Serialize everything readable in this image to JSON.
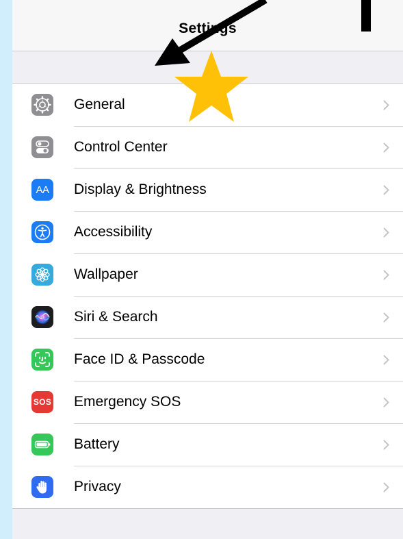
{
  "nav": {
    "title": "Settings"
  },
  "rows": [
    {
      "label": "General",
      "icon": "gear-icon",
      "icon_bg": "#8e8e93"
    },
    {
      "label": "Control Center",
      "icon": "toggles-icon",
      "icon_bg": "#8e8e93"
    },
    {
      "label": "Display & Brightness",
      "icon": "text-size-icon",
      "icon_bg": "#1c7cf4",
      "icon_text": "AA"
    },
    {
      "label": "Accessibility",
      "icon": "accessibility-icon",
      "icon_bg": "#1c7cf4"
    },
    {
      "label": "Wallpaper",
      "icon": "flower-icon",
      "icon_bg": "#36aadc"
    },
    {
      "label": "Siri & Search",
      "icon": "siri-icon",
      "icon_bg": "#1d1d1f"
    },
    {
      "label": "Face ID & Passcode",
      "icon": "face-id-icon",
      "icon_bg": "#34c759"
    },
    {
      "label": "Emergency SOS",
      "icon": "sos-icon",
      "icon_bg": "#e53935",
      "icon_text": "SOS"
    },
    {
      "label": "Battery",
      "icon": "battery-icon",
      "icon_bg": "#34c759"
    },
    {
      "label": "Privacy",
      "icon": "hand-icon",
      "icon_bg": "#2f6cf0"
    }
  ],
  "colors": {
    "page_bg": "#d0eefc",
    "screen_bg": "#efeff4",
    "nav_bg": "#f7f7f8",
    "chevron": "#c4c4c7",
    "star": "#ffc107",
    "arrow": "#000000"
  }
}
